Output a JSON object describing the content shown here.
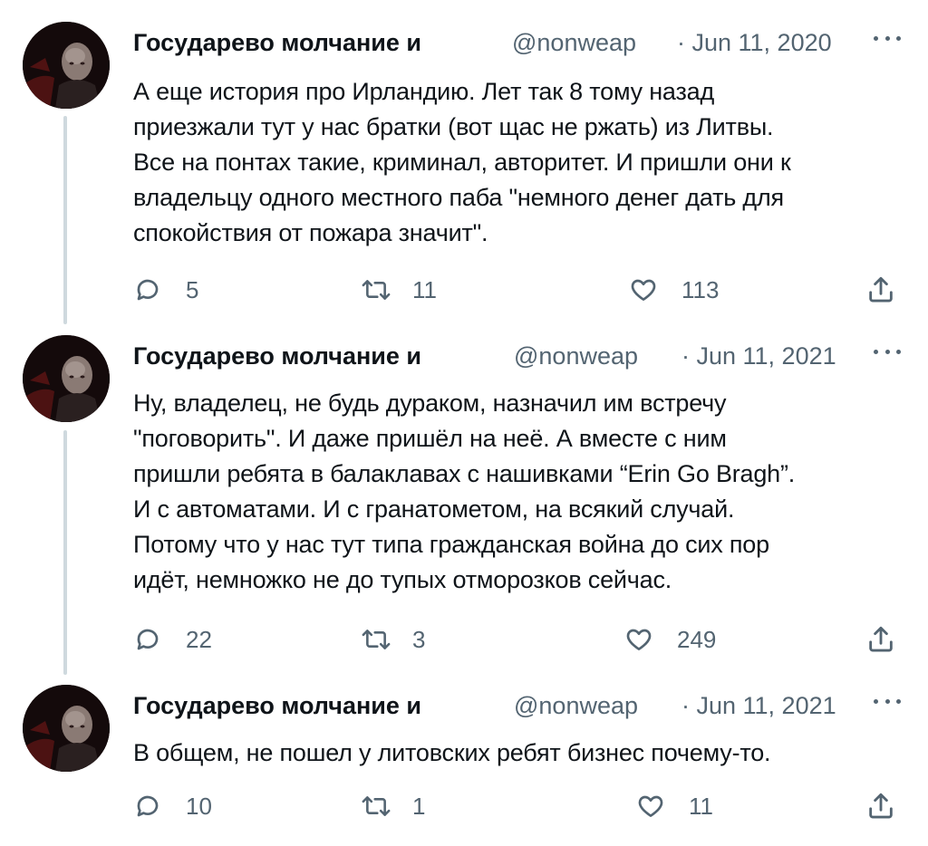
{
  "colors": {
    "text_primary": "#0f1419",
    "text_secondary": "#536471",
    "thread_line": "#cfd9de",
    "background": "#ffffff"
  },
  "icons": [
    "reply-icon",
    "retweet-icon",
    "like-icon",
    "share-icon",
    "more-icon",
    "avatar"
  ],
  "tweets": [
    {
      "name": "Государево молчание и",
      "handle": "@nonweap",
      "date": "· Jun 11, 2020",
      "text_lines": [
        "А еще история про Ирландию. Лет так 8 тому назад",
        "приезжали тут у нас братки (вот щас не ржать) из Литвы.",
        "Все на понтах такие, криминал, авторитет. И пришли они к",
        "владельцу одного местного паба \"немного денег дать для",
        "спокойствия от пожара значит\"."
      ],
      "replies": "5",
      "retweets": "11",
      "likes": "113"
    },
    {
      "name": "Государево молчание и",
      "handle": "@nonweap",
      "date": "· Jun 11, 2021",
      "text_lines": [
        "Ну, владелец, не будь дураком, назначил им встречу",
        "\"поговорить\". И даже пришёл на неё. А вместе с ним",
        "пришли ребята в балаклавах с нашивками “Erin Go Bragh”.",
        "И с автоматами. И с гранатометом, на всякий случай.",
        "Потому что у нас тут типа гражданская война до сих пор",
        "идёт, немножко не до тупых отморозков сейчас."
      ],
      "replies": "22",
      "retweets": "3",
      "likes": "249"
    },
    {
      "name": "Государево молчание и",
      "handle": "@nonweap",
      "date": "· Jun 11, 2021",
      "text_lines": [
        "В общем, не пошел у литовских ребят бизнес почему-то."
      ],
      "replies": "10",
      "retweets": "1",
      "likes": "11"
    }
  ]
}
